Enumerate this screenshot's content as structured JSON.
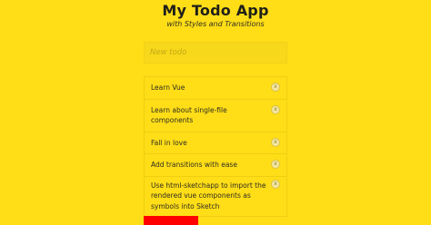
{
  "app": {
    "title": "My Todo App",
    "subtitle": "with Styles and Transitions"
  },
  "new_todo": {
    "placeholder": "New todo",
    "value": ""
  },
  "todos": [
    {
      "text": "Learn Vue",
      "remove_label": "x"
    },
    {
      "text": "Learn about single-file components",
      "remove_label": "x"
    },
    {
      "text": "Fall in love",
      "remove_label": "x"
    },
    {
      "text": "Add transitions with ease",
      "remove_label": "x"
    },
    {
      "text": "Use html-sketchapp to import the rendered vue components as symbols into Sketch",
      "remove_label": "x"
    }
  ],
  "colors": {
    "background": "#ffdd17",
    "accent_block": "#ff0000"
  }
}
